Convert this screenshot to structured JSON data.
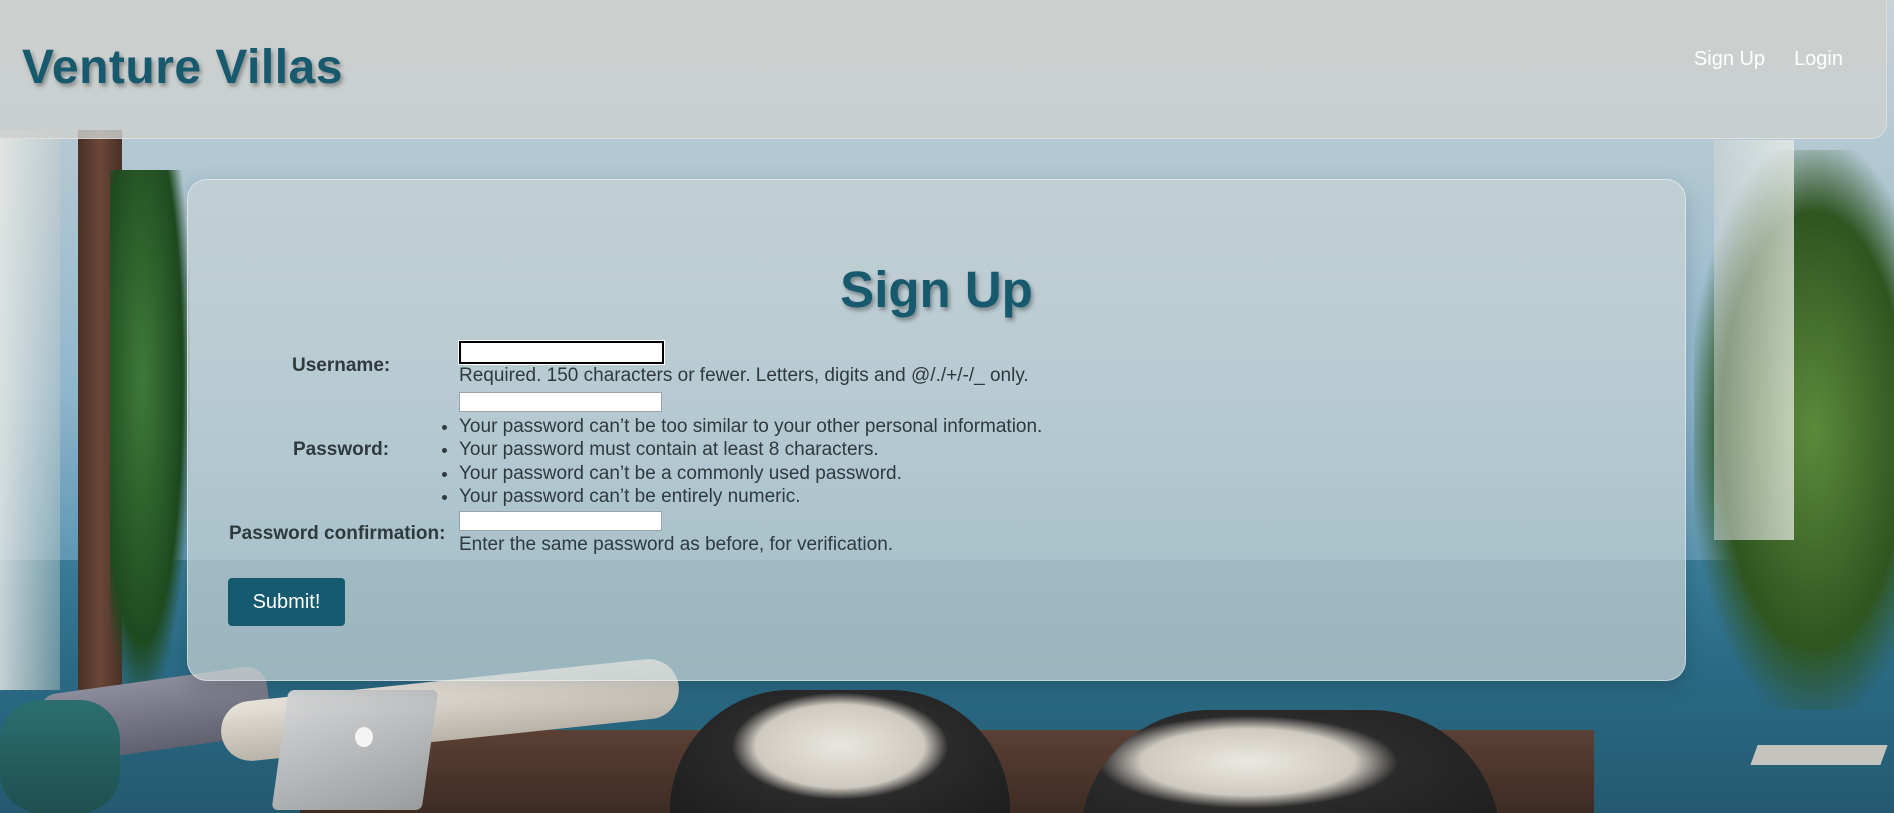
{
  "header": {
    "brand": "Venture Villas",
    "nav": {
      "signup": "Sign Up",
      "login": "Login"
    }
  },
  "form": {
    "title": "Sign Up",
    "username": {
      "label": "Username:",
      "value": "",
      "help": "Required. 150 characters or fewer. Letters, digits and @/./+/-/_ only."
    },
    "password": {
      "label": "Password:",
      "value": "",
      "rules": [
        "Your password can’t be too similar to your other personal information.",
        "Your password must contain at least 8 characters.",
        "Your password can’t be a commonly used password.",
        "Your password can’t be entirely numeric."
      ]
    },
    "password_confirmation": {
      "label": "Password confirmation:",
      "value": "",
      "help": "Enter the same password as before, for verification."
    },
    "submit_label": "Submit!"
  }
}
